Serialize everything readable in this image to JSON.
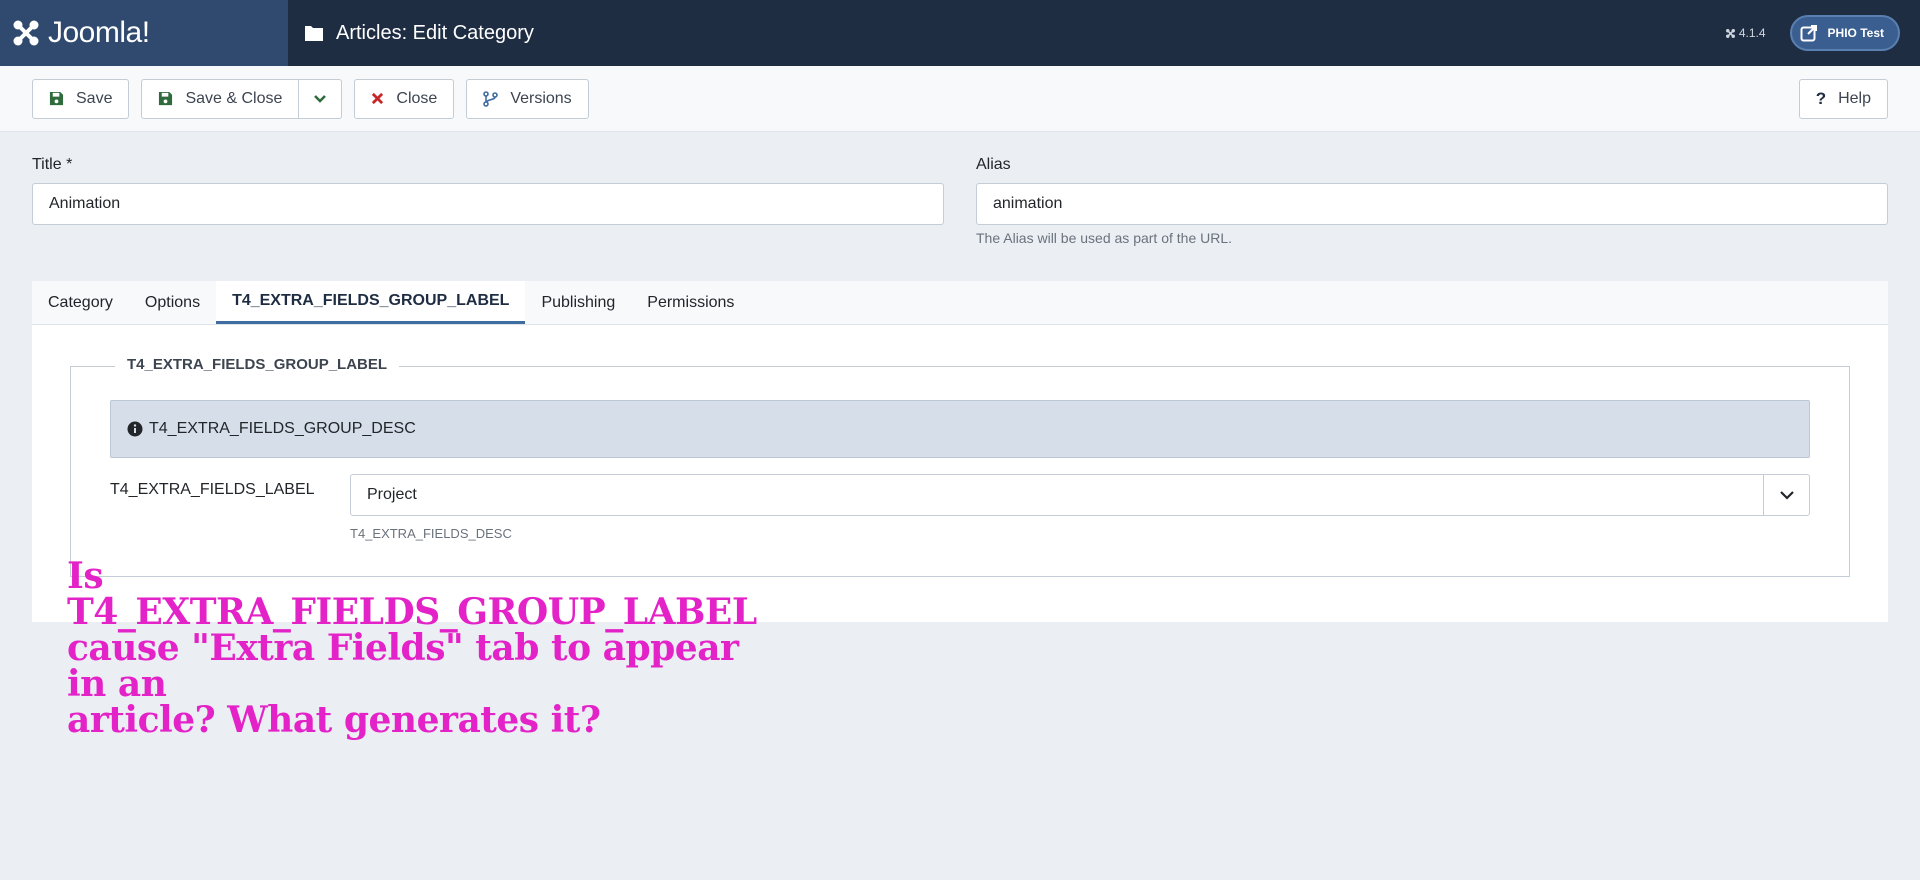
{
  "header": {
    "logo_text": "Joomla!",
    "page_title": "Articles: Edit Category",
    "version": "4.1.4",
    "user_label": "PHIO Test"
  },
  "toolbar": {
    "save": "Save",
    "save_close": "Save & Close",
    "close": "Close",
    "versions": "Versions",
    "help": "Help"
  },
  "form": {
    "title_label": "Title *",
    "title_value": "Animation",
    "alias_label": "Alias",
    "alias_value": "animation",
    "alias_hint": "The Alias will be used as part of the URL."
  },
  "tabs": [
    {
      "label": "Category"
    },
    {
      "label": "Options"
    },
    {
      "label": "T4_EXTRA_FIELDS_GROUP_LABEL"
    },
    {
      "label": "Publishing"
    },
    {
      "label": "Permissions"
    }
  ],
  "group": {
    "legend": "T4_EXTRA_FIELDS_GROUP_LABEL",
    "alert_text": "T4_EXTRA_FIELDS_GROUP_DESC",
    "field_label": "T4_EXTRA_FIELDS_LABEL",
    "field_value": "Project",
    "field_hint": "T4_EXTRA_FIELDS_DESC"
  },
  "annotation": {
    "line1": "Is T4_EXTRA_FIELDS_GROUP_LABEL",
    "line2": "cause \"Extra Fields\" tab to appear in an",
    "line3": "article? What generates it?"
  },
  "colors": {
    "header_bg": "#1f2d43",
    "logo_bg": "#2f4a6e",
    "active_tab_border": "#3f6da1",
    "close_icon": "#c52827",
    "save_icon": "#2f6b3c",
    "annotation": "#e323c8"
  }
}
